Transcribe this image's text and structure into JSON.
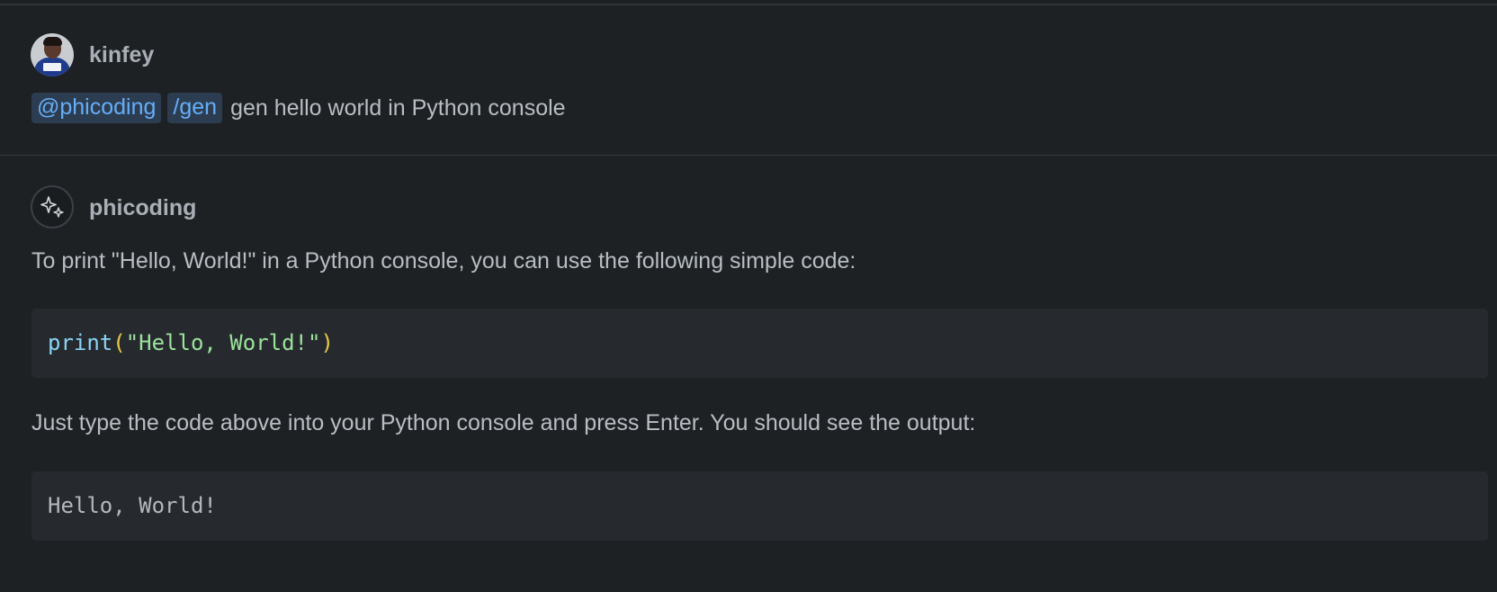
{
  "user_message": {
    "username": "kinfey",
    "mention_chip": "@phicoding",
    "command_chip": "/gen",
    "text": "gen hello world in Python console"
  },
  "assistant_message": {
    "name": "phicoding",
    "intro": "To print \"Hello, World!\" in a Python console, you can use the following simple code:",
    "code": {
      "fn": "print",
      "open": "(",
      "string": "\"Hello, World!\"",
      "close": ")"
    },
    "instruction": "Just type the code above into your Python console and press Enter. You should see the output:",
    "output": "Hello, World!"
  },
  "icons": {
    "user_avatar": "user-avatar-photo",
    "assistant_avatar": "sparkle-icon"
  },
  "colors": {
    "background": "#1d2124",
    "chip_bg": "#2c3d52",
    "chip_text": "#66aef7",
    "code_bg": "#262a2e"
  }
}
